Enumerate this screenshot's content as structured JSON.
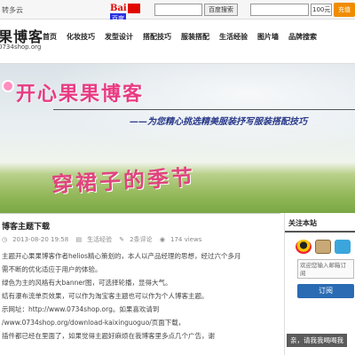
{
  "topbar": {
    "greeting": "转多云",
    "baidu_logo": "Bai",
    "baidu_text": "百度",
    "search_button": "百度搜索",
    "amount": "100元",
    "go_button": "充值"
  },
  "header": {
    "logo": "果博客",
    "domain": "0734shop.org",
    "nav": [
      "首页",
      "化妆技巧",
      "发型设计",
      "搭配技巧",
      "服装搭配",
      "生活经验",
      "图片墙",
      "品牌搜索"
    ]
  },
  "banner": {
    "title": "开心果果博客",
    "subtitle": "——为您精心挑选精美服装抒写服装搭配技巧",
    "season": "穿裙子的季节"
  },
  "post": {
    "title": "博客主题下载",
    "date": "2013-08-20 19:58",
    "category": "生活经验",
    "comments": "2条评论",
    "views": "174 views",
    "lines": [
      "主题开心果果博客作者helios精心策划的，本人以产品经理的思想，经过六个多月",
      "需不断的优化适应于用户的体验。",
      "绿色为主的风格有大banner图，可选择轮播，显得大气。",
      "结有瀑布流单页效果，可以作为淘宝客主题也可以作为个人博客主题。",
      "示网址：http://www.0734shop.org。如果喜欢请到",
      "/www.0734shop.org/download-kaixinguoguo/页面下载，",
      "插件都已经在里面了，如果觉得主题好麻烦在我博客里多点几个广告，谢"
    ]
  },
  "sidebar": {
    "header": "关注本站",
    "mail_placeholder": "欢迎您输入邮箱订阅",
    "subscribe": "订阅",
    "wish": "亲，请我我喝喝我"
  }
}
